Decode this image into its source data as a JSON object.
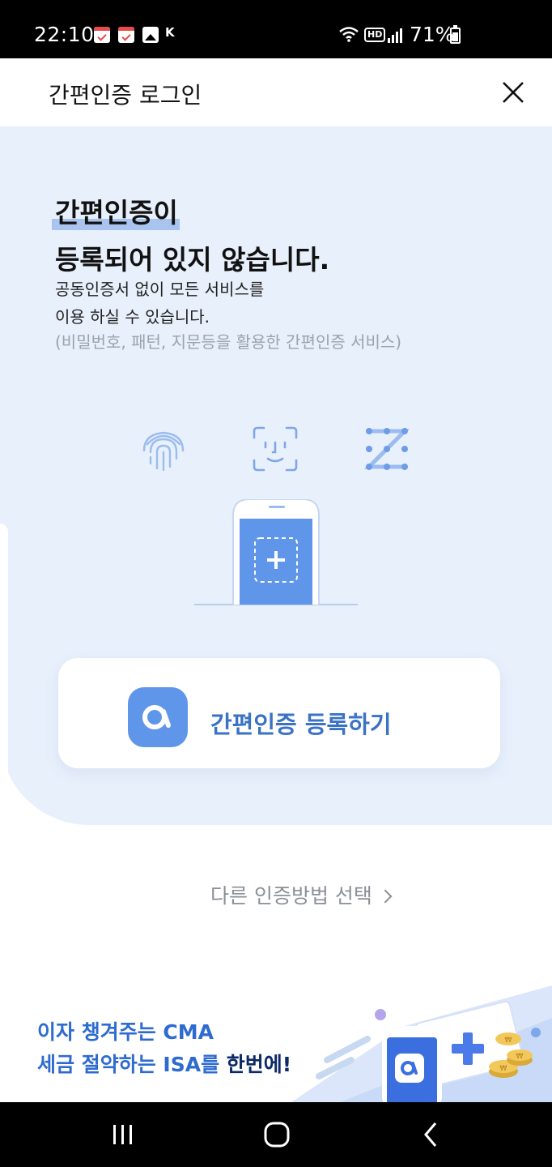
{
  "status_bar": {
    "time": "22:10",
    "battery": "71%",
    "network": "HD"
  },
  "header": {
    "title": "간편인증 로그인"
  },
  "hero": {
    "headline_line1": "간편인증이",
    "headline_line2": "등록되어 있지 않습니다.",
    "desc_line1": "공동인증서 없이 모든 서비스를",
    "desc_line2": "이용 하실 수 있습니다.",
    "desc_sub": "(비밀번호, 패턴, 지문등을 활용한 간편인증 서비스)"
  },
  "auth_methods": [
    "fingerprint-icon",
    "face-id-icon",
    "pattern-icon"
  ],
  "register": {
    "label": "간편인증 등록하기"
  },
  "other_method": {
    "label": "다른 인증방법 선택"
  },
  "banner": {
    "line1": "이자 챙겨주는 CMA",
    "line2_a": "세금 절약하는 ISA를 ",
    "line2_b": "한번에!"
  },
  "colors": {
    "panel_bg": "#e8f0fc",
    "accent": "#3a72c4",
    "banner_text": "#2e6bd0"
  }
}
